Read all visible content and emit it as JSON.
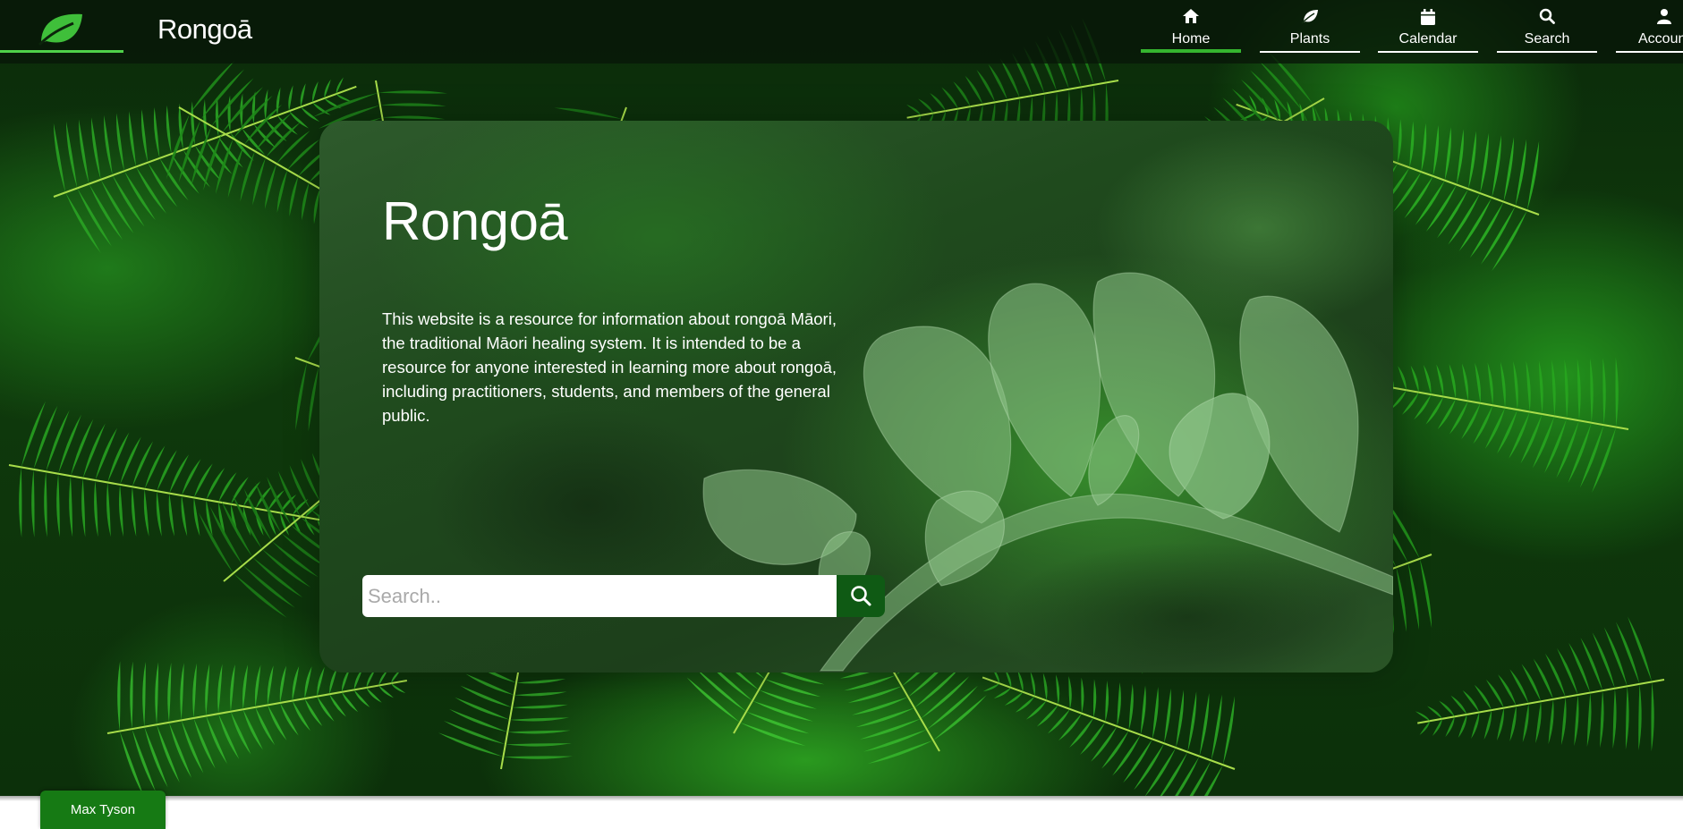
{
  "brand": {
    "logo_icon": "leaf-logo-icon",
    "name": "Rongoā"
  },
  "nav": {
    "items": [
      {
        "label": "Home",
        "icon": "home-icon",
        "active": true
      },
      {
        "label": "Plants",
        "icon": "leaf-icon",
        "active": false
      },
      {
        "label": "Calendar",
        "icon": "calendar-icon",
        "active": false
      },
      {
        "label": "Search",
        "icon": "search-icon",
        "active": false
      },
      {
        "label": "Account",
        "icon": "user-icon",
        "active": false
      }
    ]
  },
  "hero": {
    "title": "Rongoā",
    "description": "This website is a resource for information about rongoā Māori, the traditional Māori healing system. It is intended to be a resource for anyone interested in learning more about rongoā, including practitioners, students, and members of the general public.",
    "search": {
      "placeholder": "Search..",
      "value": "",
      "button_icon": "search-icon"
    }
  },
  "footer": {
    "user_name": "Max Tyson"
  },
  "colors": {
    "accent": "#35b52f",
    "nav_bg": "#081608",
    "button": "#0f5a14",
    "user_tab": "#167a14"
  }
}
